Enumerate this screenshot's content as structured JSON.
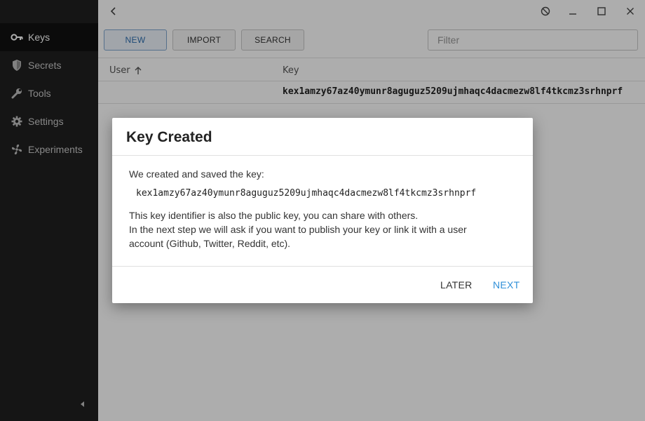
{
  "sidebar": {
    "items": [
      {
        "label": "Keys",
        "icon": "key-icon"
      },
      {
        "label": "Secrets",
        "icon": "shield-icon"
      },
      {
        "label": "Tools",
        "icon": "wrench-icon"
      },
      {
        "label": "Settings",
        "icon": "gear-icon"
      },
      {
        "label": "Experiments",
        "icon": "fan-icon"
      }
    ],
    "active": "Keys"
  },
  "toolbar": {
    "new_label": "NEW",
    "import_label": "IMPORT",
    "search_label": "SEARCH",
    "filter_placeholder": "Filter"
  },
  "table": {
    "columns": [
      "User",
      "Key"
    ],
    "sort_column": "User",
    "sort_direction": "ascending",
    "rows": [
      {
        "user": "",
        "key": "kex1amzy67az40ymunr8aguguz5209ujmhaqc4dacmezw8lf4tkcmz3srhnprf"
      }
    ]
  },
  "dialog": {
    "title": "Key Created",
    "intro": "We created and saved the key:",
    "key": "kex1amzy67az40ymunr8aguguz5209ujmhaqc4dacmezw8lf4tkcmz3srhnprf",
    "line1": "This key identifier is also the public key, you can share with others.",
    "line2": "In the next step we will ask if you want to publish your key or link it with a user",
    "line3": "account (Github, Twitter, Reddit, etc).",
    "later_label": "LATER",
    "next_label": "NEXT"
  },
  "colors": {
    "sidebar_bg": "#1f1f1f",
    "accent": "#2f8fd8",
    "overlay": "rgba(0,0,0,0.32)"
  }
}
